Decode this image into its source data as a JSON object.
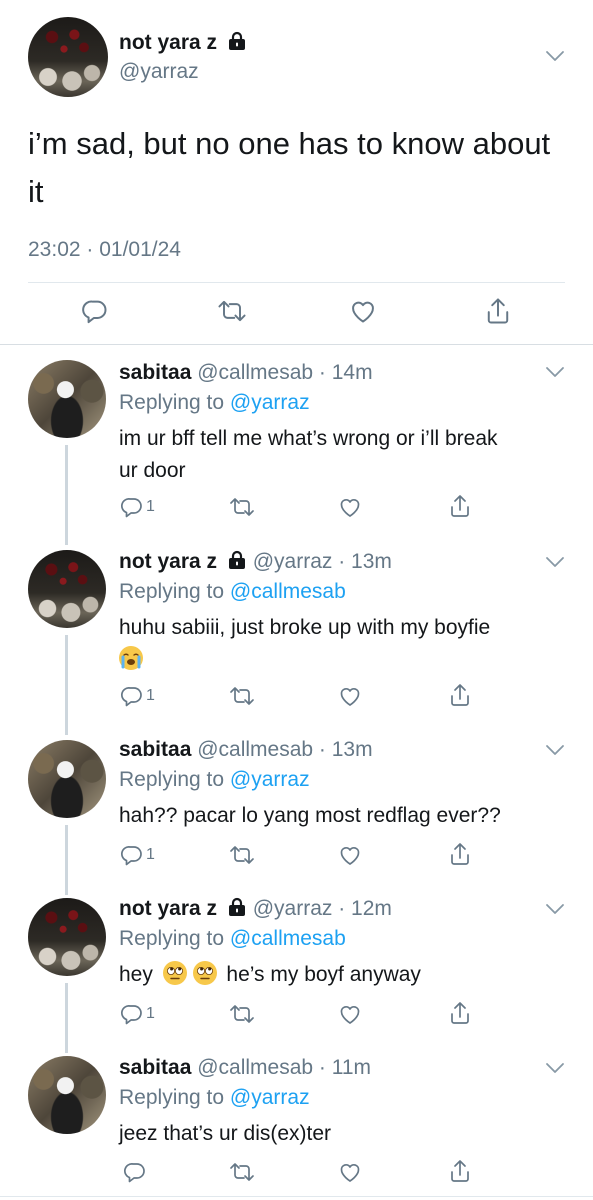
{
  "main_tweet": {
    "name": "not yara z",
    "handle": "@yarraz",
    "text_line1": "i’m sad, but no one has to know about",
    "text_line2": "it",
    "timestamp": "23:02 · 01/01/24"
  },
  "replies": [
    {
      "name": "sabitaa",
      "handle_time": " @callmesab · 14m",
      "replying_prefix": "Replying to ",
      "replying_to": "@yarraz",
      "text_line1": "im ur bff tell me what’s wrong or i’ll break",
      "text_line2": "ur door",
      "reply_count": "1"
    },
    {
      "name": "not yara z",
      "handle_time": " @yarraz · 13m",
      "replying_prefix": "Replying to ",
      "replying_to": "@callmesab",
      "text_line1": "huhu sabiii, just broke up with my boyfie",
      "emoji": "loudly-crying-face",
      "reply_count": "1"
    },
    {
      "name": "sabitaa",
      "handle_time": " @callmesab · 13m",
      "replying_prefix": "Replying to ",
      "replying_to": "@yarraz",
      "text_line1": "hah?? pacar lo yang most redflag ever??",
      "reply_count": "1"
    },
    {
      "name": "not yara z",
      "handle_time": " @yarraz · 12m",
      "replying_prefix": "Replying to ",
      "replying_to": "@callmesab",
      "text_before": "hey",
      "emoji": "face-with-rolling-eyes",
      "text_after": "he’s my boyf anyway",
      "reply_count": "1"
    },
    {
      "name": "sabitaa",
      "handle_time": " @callmesab · 11m",
      "replying_prefix": "Replying to ",
      "replying_to": "@yarraz",
      "text_line1": "jeez that’s ur dis(ex)ter",
      "reply_count": ""
    }
  ],
  "colors": {
    "link_blue": "#1da1f2",
    "secondary_gray": "#657786",
    "icon_gray": "#657786",
    "thread_line": "#cdd6dd"
  }
}
